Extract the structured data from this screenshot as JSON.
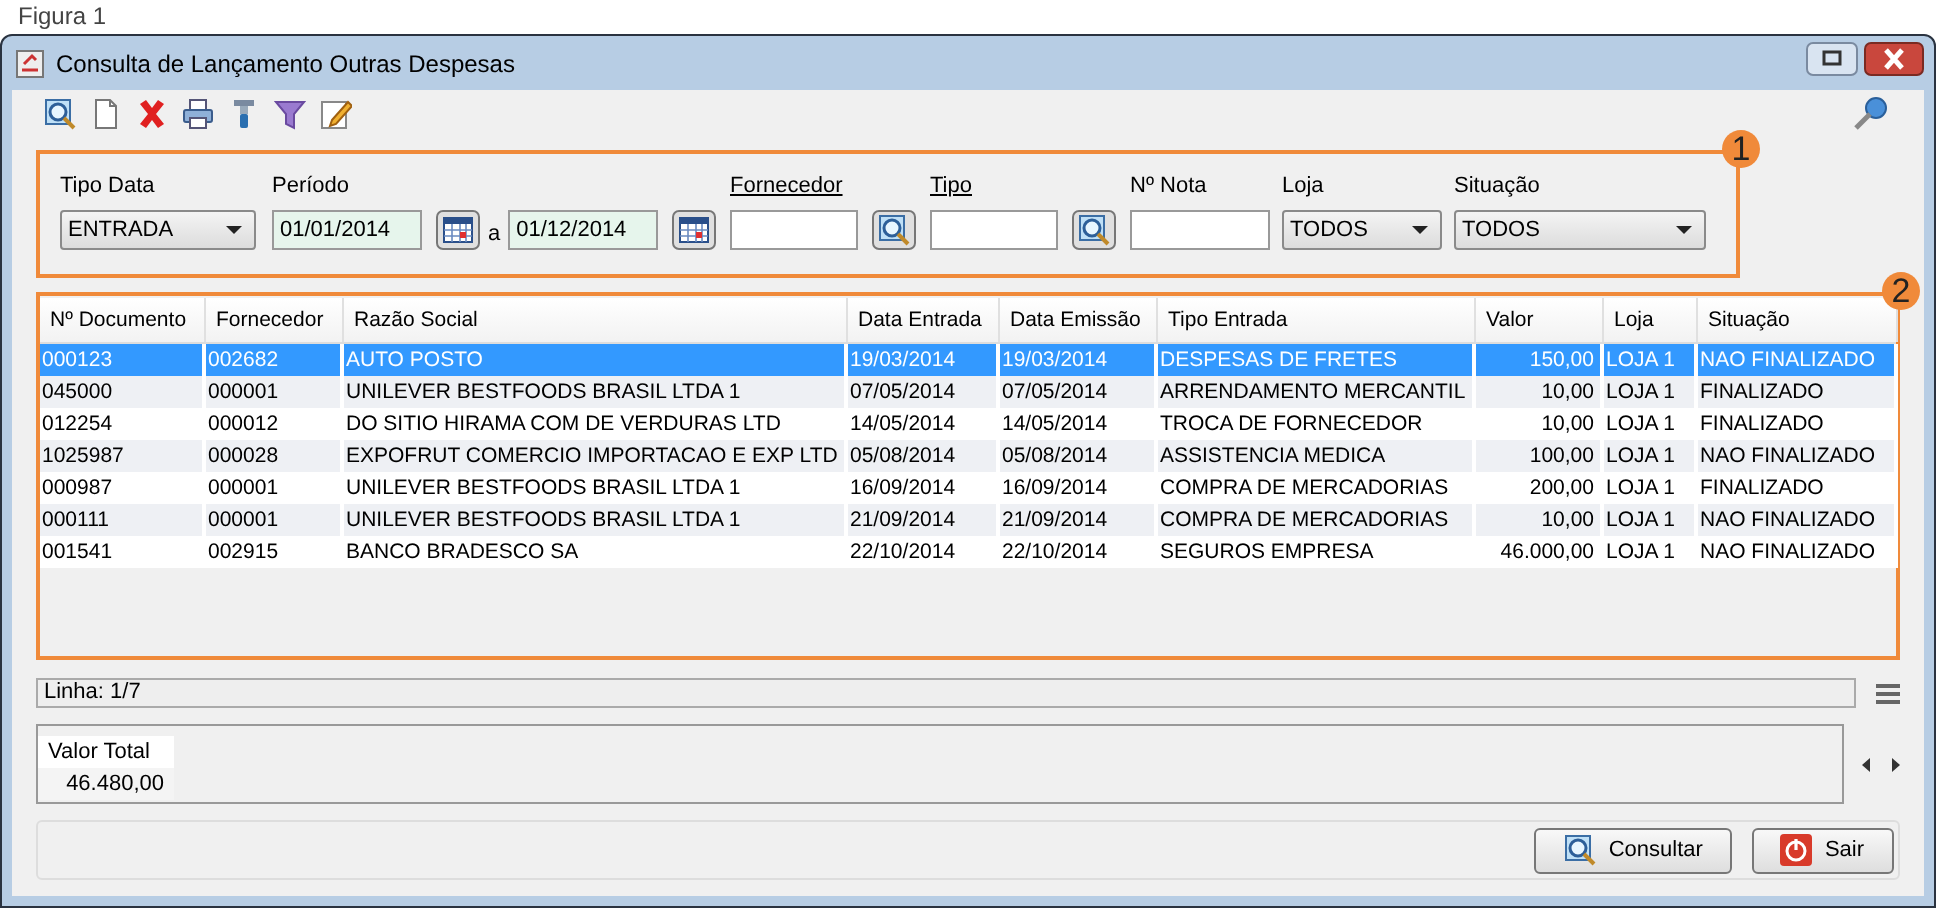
{
  "caption": "Figura 1",
  "window": {
    "title": "Consulta de Lançamento Outras Despesas"
  },
  "toolbar": [
    {
      "kind": "search"
    },
    {
      "kind": "new"
    },
    {
      "kind": "delete"
    },
    {
      "kind": "print"
    },
    {
      "kind": "tool"
    },
    {
      "kind": "filter"
    },
    {
      "kind": "edit"
    }
  ],
  "filters": [
    {
      "kind": "select",
      "label": "Tipo Data",
      "value": "ENTRADA"
    },
    {
      "kind": "daterange",
      "label": "Período",
      "from": "01/01/2014",
      "separator": "a",
      "to": "01/12/2014"
    },
    {
      "kind": "lookup",
      "label": "Fornecedor"
    },
    {
      "kind": "lookup",
      "label": "Tipo"
    },
    {
      "kind": "text",
      "label": "Nº Nota"
    },
    {
      "kind": "select",
      "label": "Loja",
      "value": "TODOS"
    },
    {
      "kind": "select",
      "label": "Situação",
      "value": "TODOS"
    }
  ],
  "annotations": [
    "1",
    "2"
  ],
  "table": {
    "columns": [
      "Nº Documento",
      "Fornecedor",
      "Razão Social",
      "Data Entrada",
      "Data Emissão",
      "Tipo Entrada",
      "Valor",
      "Loja",
      "Situação"
    ],
    "rows": [
      {
        "selected": true,
        "cells": [
          "000123",
          "002682",
          "AUTO POSTO",
          "19/03/2014",
          "19/03/2014",
          "DESPESAS DE FRETES",
          "150,00",
          "LOJA 1",
          "NAO FINALIZADO"
        ]
      },
      {
        "selected": false,
        "cells": [
          "045000",
          "000001",
          "UNILEVER BESTFOODS BRASIL LTDA 1",
          "07/05/2014",
          "07/05/2014",
          "ARRENDAMENTO MERCANTIL",
          "10,00",
          "LOJA 1",
          "FINALIZADO"
        ]
      },
      {
        "selected": false,
        "cells": [
          "012254",
          "000012",
          "DO SITIO HIRAMA COM DE VERDURAS LTD",
          "14/05/2014",
          "14/05/2014",
          "TROCA DE FORNECEDOR",
          "10,00",
          "LOJA 1",
          "FINALIZADO"
        ]
      },
      {
        "selected": false,
        "cells": [
          "1025987",
          "000028",
          "EXPOFRUT COMERCIO IMPORTACAO E EXP LTD",
          "05/08/2014",
          "05/08/2014",
          "ASSISTENCIA MEDICA",
          "100,00",
          "LOJA 1",
          "NAO FINALIZADO"
        ]
      },
      {
        "selected": false,
        "cells": [
          "000987",
          "000001",
          "UNILEVER BESTFOODS BRASIL LTDA 1",
          "16/09/2014",
          "16/09/2014",
          "COMPRA DE MERCADORIAS",
          "200,00",
          "LOJA 1",
          "FINALIZADO"
        ]
      },
      {
        "selected": false,
        "cells": [
          "000111",
          "000001",
          "UNILEVER BESTFOODS BRASIL LTDA 1",
          "21/09/2014",
          "21/09/2014",
          "COMPRA DE MERCADORIAS",
          "10,00",
          "LOJA 1",
          "NAO FINALIZADO"
        ]
      },
      {
        "selected": false,
        "cells": [
          "001541",
          "002915",
          "BANCO BRADESCO SA",
          "22/10/2014",
          "22/10/2014",
          "SEGUROS EMPRESA",
          "46.000,00",
          "LOJA 1",
          "NAO FINALIZADO"
        ]
      }
    ]
  },
  "status_bar": "Linha: 1/7",
  "totals": {
    "label": "Valor Total",
    "value": "46.480,00"
  },
  "buttons": [
    {
      "kind": "search",
      "label": "Consultar"
    },
    {
      "kind": "exit",
      "label": "Sair"
    }
  ]
}
